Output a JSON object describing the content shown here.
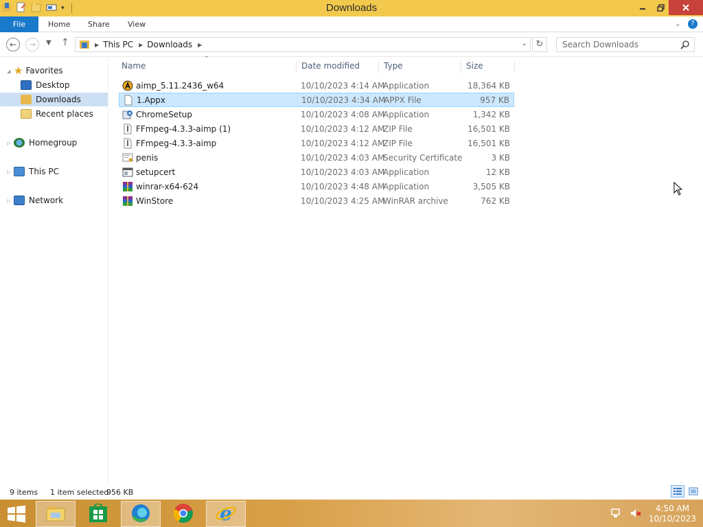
{
  "window": {
    "title": "Downloads"
  },
  "ribbon": {
    "file": "File",
    "home": "Home",
    "share": "Share",
    "view": "View"
  },
  "address": {
    "crumbs": [
      "This PC",
      "Downloads"
    ],
    "search_placeholder": "Search Downloads"
  },
  "nav": {
    "favorites": "Favorites",
    "desktop": "Desktop",
    "downloads": "Downloads",
    "recent": "Recent places",
    "homegroup": "Homegroup",
    "thispc": "This PC",
    "network": "Network"
  },
  "columns": {
    "name": "Name",
    "date": "Date modified",
    "type": "Type",
    "size": "Size"
  },
  "files": [
    {
      "name": "aimp_5.11.2436_w64",
      "date": "10/10/2023 4:14 AM",
      "type": "Application",
      "size": "18,364 KB",
      "icon": "aimp-icon"
    },
    {
      "name": "1.Appx",
      "date": "10/10/2023 4:34 AM",
      "type": "APPX File",
      "size": "957 KB",
      "icon": "blank-file-icon",
      "selected": true
    },
    {
      "name": "ChromeSetup",
      "date": "10/10/2023 4:08 AM",
      "type": "Application",
      "size": "1,342 KB",
      "icon": "setup-icon"
    },
    {
      "name": "FFmpeg-4.3.3-aimp (1)",
      "date": "10/10/2023 4:12 AM",
      "type": "ZIP File",
      "size": "16,501 KB",
      "icon": "zip-icon"
    },
    {
      "name": "FFmpeg-4.3.3-aimp",
      "date": "10/10/2023 4:12 AM",
      "type": "ZIP File",
      "size": "16,501 KB",
      "icon": "zip-icon"
    },
    {
      "name": "penis",
      "date": "10/10/2023 4:03 AM",
      "type": "Security Certificate",
      "size": "3 KB",
      "icon": "certificate-icon"
    },
    {
      "name": "setupcert",
      "date": "10/10/2023 4:03 AM",
      "type": "Application",
      "size": "12 KB",
      "icon": "app-window-icon"
    },
    {
      "name": "winrar-x64-624",
      "date": "10/10/2023 4:48 AM",
      "type": "Application",
      "size": "3,505 KB",
      "icon": "winrar-icon"
    },
    {
      "name": "WinStore",
      "date": "10/10/2023 4:25 AM",
      "type": "WinRAR archive",
      "size": "762 KB",
      "icon": "winrar-icon"
    }
  ],
  "status": {
    "count": "9 items",
    "selected": "1 item selected",
    "size": "956 KB"
  },
  "taskbar": {
    "time": "4:50 AM",
    "date": "10/10/2023"
  },
  "colors": {
    "accent": "#1979ca",
    "title_bar": "#f2c94c",
    "selection": "#cce8ff",
    "close": "#c7423b"
  }
}
